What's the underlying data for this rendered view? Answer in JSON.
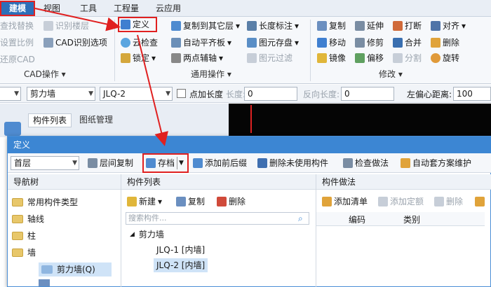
{
  "menubar": {
    "items": [
      "建模",
      "视图",
      "工具",
      "工程量",
      "云应用"
    ]
  },
  "ribbon": {
    "cad_group": {
      "items": [
        "查找替换",
        "识别楼层",
        "设置比例",
        "CAD识别选项",
        "还原CAD"
      ],
      "label": "CAD操作"
    },
    "general_group": {
      "define": "定义",
      "cloud_check": "云检查",
      "lock": "锁定",
      "copy_to_floor": "复制到其它层",
      "auto_flat": "自动平齐板",
      "two_point_axis": "两点辅轴",
      "length_mark": "长度标注",
      "element_save": "图元存盘",
      "element_filter": "图元过滤",
      "label": "通用操作"
    },
    "modify_group": {
      "copy": "复制",
      "extend": "延伸",
      "break": "打断",
      "align": "对齐",
      "move": "移动",
      "trim": "修剪",
      "merge": "合并",
      "delete": "删除",
      "mirror": "镜像",
      "offset": "偏移",
      "split": "分割",
      "rotate": "旋转",
      "label": "修改"
    }
  },
  "optionbar": {
    "type_value": "剪力墙",
    "element_value": "JLQ-2",
    "point_length_label": "点加长度",
    "length_label": "长度:",
    "length_value": "0",
    "reverse_length_label": "反向长度:",
    "reverse_length_value": "0",
    "left_offset_label": "左偏心距离:",
    "left_offset_value": "100"
  },
  "background_panel": {
    "tab1": "构件列表",
    "tab2": "图纸管理"
  },
  "dialog": {
    "title": "定义",
    "floor_value": "首层",
    "toolbar": {
      "copy_between_floors": "层间复制",
      "save": "存档",
      "add_prefix_suffix": "添加前后缀",
      "delete_unused": "删除未使用构件",
      "check_method": "检查做法",
      "auto_method_maintain": "自动套方案维护"
    },
    "nav": {
      "header": "导航树",
      "items": [
        "常用构件类型",
        "轴线",
        "柱",
        "墙",
        "剪力墙(Q)"
      ]
    },
    "component_list": {
      "header": "构件列表",
      "new": "新建",
      "copy": "复制",
      "delete": "删除",
      "search_placeholder": "搜索构件...",
      "group": "剪力墙",
      "items": [
        "JLQ-1 [内墙]",
        "JLQ-2 [内墙]"
      ]
    },
    "method": {
      "header": "构件做法",
      "add_list": "添加清单",
      "add_quota": "添加定额",
      "delete": "删除",
      "col_code": "编码",
      "col_category": "类别"
    }
  },
  "colors": {
    "accent": "#3c86d3",
    "highlight": "#e02020",
    "viewport": "#050505"
  }
}
